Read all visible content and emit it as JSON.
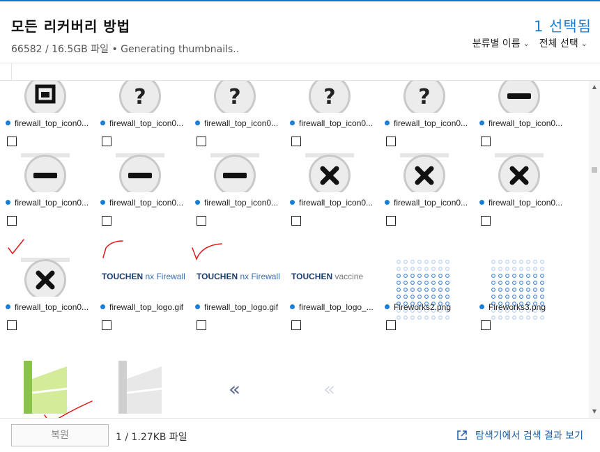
{
  "header": {
    "title": "모든 리커버리 방법",
    "subtitle": "66582 / 16.5GB 파일 • Generating thumbnails..",
    "selected_count": "1 선택됨",
    "sort_label": "분류별 이름",
    "select_all_label": "전체 선택"
  },
  "files": [
    {
      "name": "firewall_top_icon0...",
      "icon": "lock-icon"
    },
    {
      "name": "firewall_top_icon0...",
      "icon": "question-icon"
    },
    {
      "name": "firewall_top_icon0...",
      "icon": "question-icon"
    },
    {
      "name": "firewall_top_icon0...",
      "icon": "question-icon"
    },
    {
      "name": "firewall_top_icon0...",
      "icon": "question-icon"
    },
    {
      "name": "firewall_top_icon0...",
      "icon": "minus-icon"
    },
    {
      "name": "firewall_top_icon0...",
      "icon": "minus-icon"
    },
    {
      "name": "firewall_top_icon0...",
      "icon": "minus-icon"
    },
    {
      "name": "firewall_top_icon0...",
      "icon": "minus-icon"
    },
    {
      "name": "firewall_top_icon0...",
      "icon": "x-icon"
    },
    {
      "name": "firewall_top_icon0...",
      "icon": "x-icon"
    },
    {
      "name": "firewall_top_icon0...",
      "icon": "x-icon"
    },
    {
      "name": "firewall_top_icon0...",
      "icon": "x-icon"
    },
    {
      "name": "firewall_top_logo.gif",
      "icon": "touchen-firewall-logo",
      "logo_text": "TOUCHEN nx Firewall"
    },
    {
      "name": "firewall_top_logo.gif",
      "icon": "touchen-firewall-logo",
      "logo_text": "TOUCHEN nx Firewall"
    },
    {
      "name": "firewall_top_logo_...",
      "icon": "touchen-vaccine-logo",
      "logo_text": "TOUCHEN vaccine"
    },
    {
      "name": "Fireworks2.png",
      "icon": "fireworks-dots-icon"
    },
    {
      "name": "Fireworks3.png",
      "icon": "fireworks-dots-icon"
    },
    {
      "name": "",
      "icon": "green-flag-icon"
    },
    {
      "name": "",
      "icon": "gray-flag-icon"
    },
    {
      "name": "",
      "icon": "double-chevron-left-icon"
    },
    {
      "name": "",
      "icon": "double-chevron-left-faded-icon"
    }
  ],
  "footer": {
    "restore_label": "복원",
    "selection_info": "1 / 1.27KB 파일",
    "view_link_label": "탐색기에서 검색 결과 보기"
  },
  "colors": {
    "accent": "#1a7fd4",
    "top_bar": "#0a78d7",
    "annotation": "#e01a1a"
  }
}
